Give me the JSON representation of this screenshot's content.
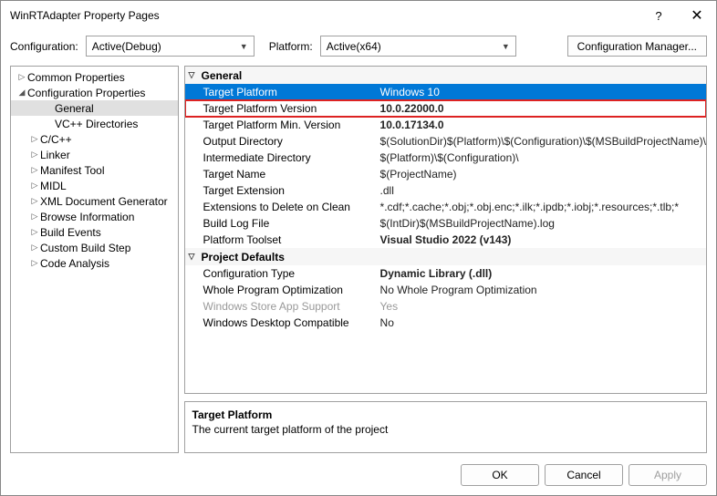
{
  "title": "WinRTAdapter Property Pages",
  "toolbar": {
    "configLabel": "Configuration:",
    "configValue": "Active(Debug)",
    "platformLabel": "Platform:",
    "platformValue": "Active(x64)",
    "cfgMgr": "Configuration Manager..."
  },
  "tree": {
    "top": [
      {
        "label": "Common Properties",
        "tw": "▷"
      },
      {
        "label": "Configuration Properties",
        "tw": "◢"
      }
    ],
    "children": [
      "General",
      "VC++ Directories",
      "C/C++",
      "Linker",
      "Manifest Tool",
      "MIDL",
      "XML Document Generator",
      "Browse Information",
      "Build Events",
      "Custom Build Step",
      "Code Analysis"
    ]
  },
  "sections": [
    {
      "title": "General",
      "rows": [
        {
          "label": "Target Platform",
          "val": "Windows 10",
          "sel": true
        },
        {
          "label": "Target Platform Version",
          "val": "10.0.22000.0",
          "bold": true,
          "hl": true
        },
        {
          "label": "Target Platform Min. Version",
          "val": "10.0.17134.0",
          "bold": true
        },
        {
          "label": "Output Directory",
          "val": "$(SolutionDir)$(Platform)\\$(Configuration)\\$(MSBuildProjectName)\\"
        },
        {
          "label": "Intermediate Directory",
          "val": "$(Platform)\\$(Configuration)\\"
        },
        {
          "label": "Target Name",
          "val": "$(ProjectName)"
        },
        {
          "label": "Target Extension",
          "val": ".dll"
        },
        {
          "label": "Extensions to Delete on Clean",
          "val": "*.cdf;*.cache;*.obj;*.obj.enc;*.ilk;*.ipdb;*.iobj;*.resources;*.tlb;*"
        },
        {
          "label": "Build Log File",
          "val": "$(IntDir)$(MSBuildProjectName).log"
        },
        {
          "label": "Platform Toolset",
          "val": "Visual Studio 2022 (v143)",
          "bold": true
        }
      ]
    },
    {
      "title": "Project Defaults",
      "rows": [
        {
          "label": "Configuration Type",
          "val": "Dynamic Library (.dll)",
          "bold": true
        },
        {
          "label": "Whole Program Optimization",
          "val": "No Whole Program Optimization"
        },
        {
          "label": "Windows Store App Support",
          "val": "Yes",
          "dim": true
        },
        {
          "label": "Windows Desktop Compatible",
          "val": "No"
        }
      ]
    }
  ],
  "desc": {
    "title": "Target Platform",
    "text": "The current target platform of the project"
  },
  "footer": {
    "ok": "OK",
    "cancel": "Cancel",
    "apply": "Apply"
  }
}
